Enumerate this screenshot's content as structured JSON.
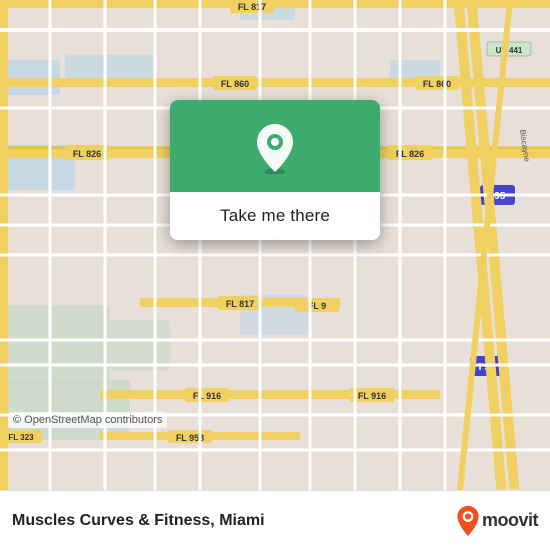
{
  "map": {
    "background_color": "#e8e0d8",
    "attribution": "© OpenStreetMap contributors"
  },
  "popup": {
    "button_label": "Take me there",
    "accent_color": "#3dab6e"
  },
  "bottom_bar": {
    "place_name": "Muscles Curves & Fitness, Miami",
    "logo_text": "moovit"
  }
}
